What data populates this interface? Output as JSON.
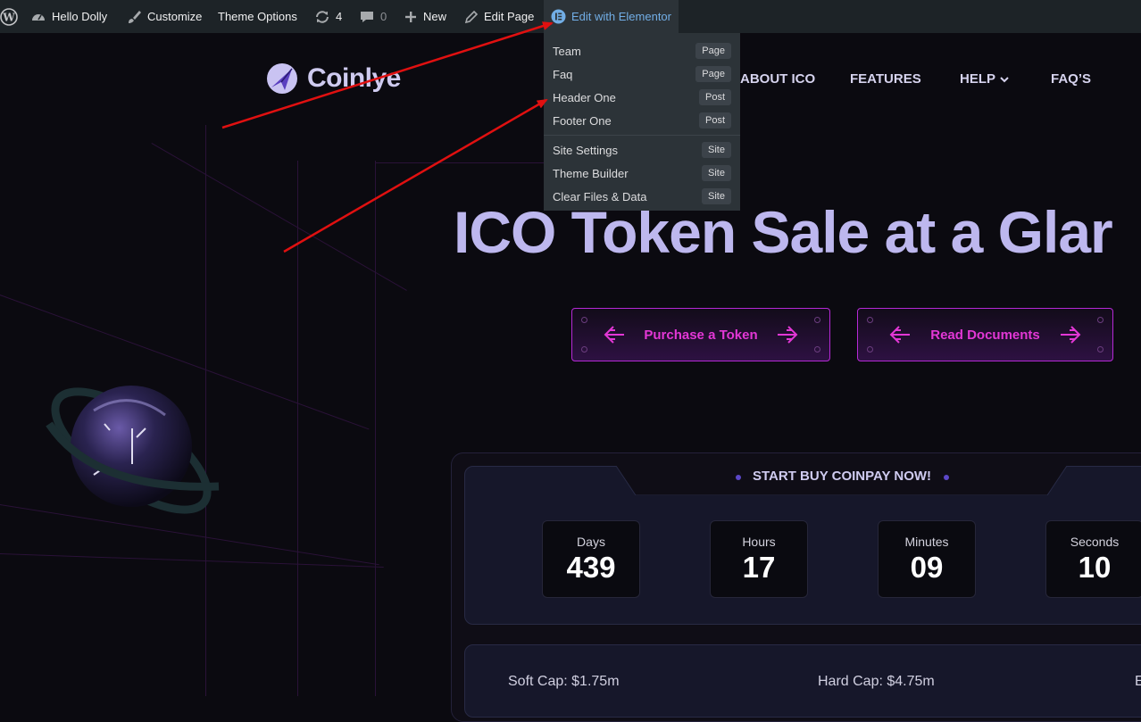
{
  "admin_bar": {
    "site_name": "Hello Dolly",
    "customize": "Customize",
    "theme_options": "Theme Options",
    "updates_count": "4",
    "comments_count": "0",
    "new": "New",
    "edit_page": "Edit Page",
    "edit_with_elementor": "Edit with Elementor"
  },
  "elementor_menu": {
    "items": [
      {
        "label": "Team",
        "badge": "Page"
      },
      {
        "label": "Faq",
        "badge": "Page"
      },
      {
        "label": "Header One",
        "badge": "Post"
      },
      {
        "label": "Footer One",
        "badge": "Post"
      }
    ],
    "site_items": [
      {
        "label": "Site Settings",
        "badge": "Site"
      },
      {
        "label": "Theme Builder",
        "badge": "Site"
      },
      {
        "label": "Clear Files & Data",
        "badge": "Site"
      }
    ]
  },
  "header": {
    "logo_text": "Coinlye",
    "nav": {
      "about": "ABOUT ICO",
      "features": "FEATURES",
      "help": "HELP",
      "faqs": "FAQ’S"
    }
  },
  "hero": {
    "title": "ICO Token Sale at a Glar",
    "buttons": {
      "purchase": "Purchase a Token",
      "docs": "Read Documents"
    }
  },
  "countdown": {
    "heading": "START BUY COINPAY NOW!",
    "days_label": "Days",
    "days_value": "439",
    "hours_label": "Hours",
    "hours_value": "17",
    "minutes_label": "Minutes",
    "minutes_value": "09",
    "seconds_label": "Seconds",
    "seconds_value": "10"
  },
  "caps": {
    "soft": "Soft Cap: $1.75m",
    "hard": "Hard Cap: $4.75m",
    "edge": "E"
  },
  "colors": {
    "accent_magenta": "#e337d6",
    "title_lavender": "#bdb7ee",
    "elementor_blue": "#72aee6",
    "annotation_red": "#e01010"
  }
}
